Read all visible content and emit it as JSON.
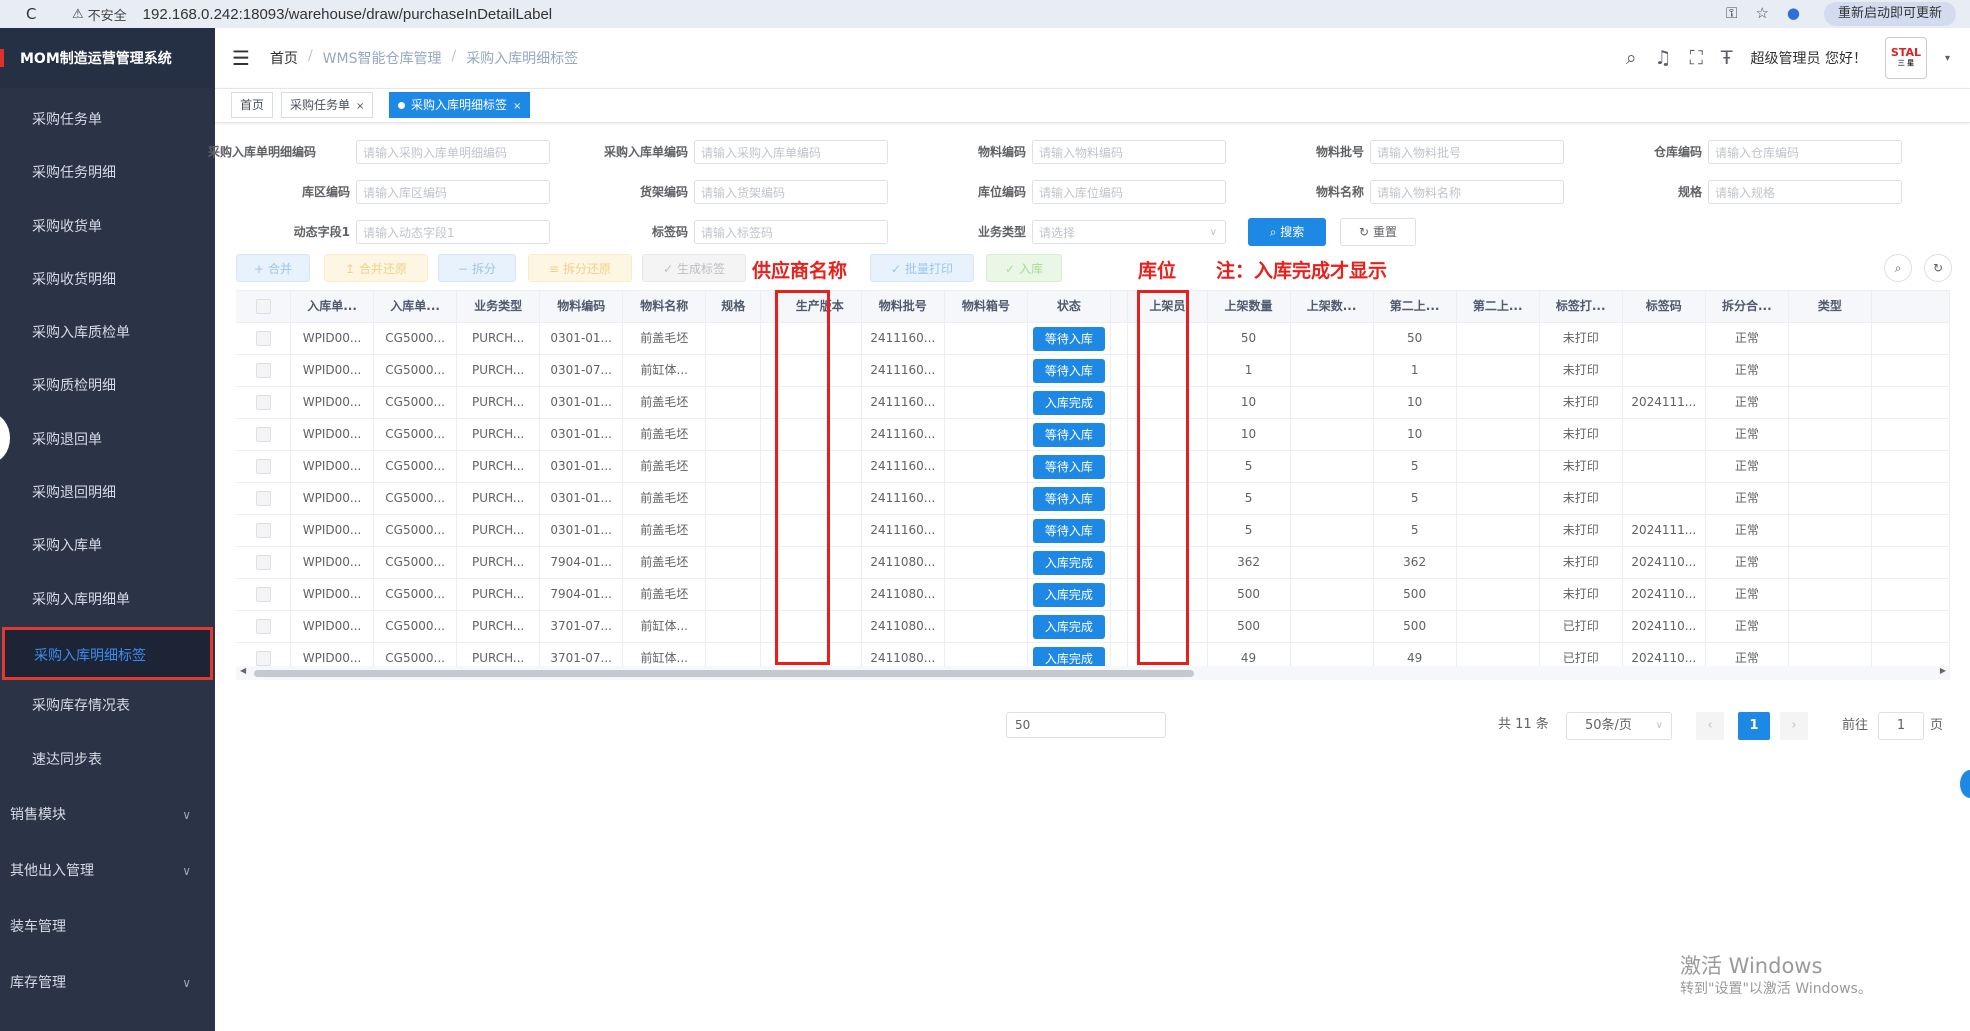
{
  "browser": {
    "reload": "C",
    "not_secure": "不安全",
    "url": "192.168.0.242:18093/warehouse/draw/purchaseInDetailLabel",
    "restart": "重新启动即可更新"
  },
  "sidebar": {
    "brand": "MOM制造运营管理系统",
    "items": [
      {
        "label": "采购任务单"
      },
      {
        "label": "采购任务明细"
      },
      {
        "label": "采购收货单"
      },
      {
        "label": "采购收货明细"
      },
      {
        "label": "采购入库质检单"
      },
      {
        "label": "采购质检明细"
      },
      {
        "label": "采购退回单"
      },
      {
        "label": "采购退回明细"
      },
      {
        "label": "采购入库单"
      },
      {
        "label": "采购入库明细单"
      },
      {
        "label": "采购入库明细标签"
      },
      {
        "label": "采购库存情况表"
      },
      {
        "label": "速达同步表"
      }
    ],
    "groups": [
      {
        "label": "销售模块"
      },
      {
        "label": "其他出入管理"
      },
      {
        "label": "装车管理"
      },
      {
        "label": "库存管理"
      }
    ]
  },
  "header": {
    "breadcrumb": [
      "首页",
      "WMS智能仓库管理",
      "采购入库明细标签"
    ],
    "greeting": "超级管理员 您好！",
    "avatar_text": "STAL",
    "avatar_sub": "三 星"
  },
  "tags": [
    {
      "label": "首页"
    },
    {
      "label": "采购任务单"
    },
    {
      "label": "采购入库明细标签"
    }
  ],
  "filters": [
    {
      "label": "采购入库单明细编码",
      "placeholder": "请输入采购入库单明细编码"
    },
    {
      "label": "采购入库单编码",
      "placeholder": "请输入采购入库单编码"
    },
    {
      "label": "物料编码",
      "placeholder": "请输入物料编码"
    },
    {
      "label": "物料批号",
      "placeholder": "请输入物料批号"
    },
    {
      "label": "仓库编码",
      "placeholder": "请输入仓库编码"
    },
    {
      "label": "库区编码",
      "placeholder": "请输入库区编码"
    },
    {
      "label": "货架编码",
      "placeholder": "请输入货架编码"
    },
    {
      "label": "库位编码",
      "placeholder": "请输入库位编码"
    },
    {
      "label": "物料名称",
      "placeholder": "请输入物料名称"
    },
    {
      "label": "规格",
      "placeholder": "请输入规格"
    },
    {
      "label": "动态字段1",
      "placeholder": "请输入动态字段1"
    },
    {
      "label": "标签码",
      "placeholder": "请输入标签码"
    },
    {
      "label": "业务类型",
      "placeholder": "请选择"
    }
  ],
  "buttons": {
    "search": "搜索",
    "reset": "重置"
  },
  "toolbar": [
    {
      "label": "合并",
      "icon": "+"
    },
    {
      "label": "合并还原",
      "icon": "↥"
    },
    {
      "label": "拆分",
      "icon": "−"
    },
    {
      "label": "拆分还原",
      "icon": "≡"
    },
    {
      "label": "生成标签",
      "icon": "✓"
    },
    {
      "label": "批量打印",
      "icon": "✓"
    },
    {
      "label": "入库",
      "icon": "✓"
    }
  ],
  "annotations": {
    "supplier": "供应商名称",
    "location": "库位",
    "note": "注：入库完成才显示"
  },
  "table": {
    "columns": [
      "",
      "入库单...",
      "入库单...",
      "业务类型",
      "物料编码",
      "物料名称",
      "规格",
      "",
      "生产版本",
      "物料批号",
      "物料箱号",
      "状态",
      "",
      "上架员",
      "上架数量",
      "上架数...",
      "第二上...",
      "第二上...",
      "标签打...",
      "标签码",
      "拆分合...",
      "类型",
      ""
    ],
    "rows": [
      {
        "c1": "WPID00...",
        "c2": "CG5000...",
        "c3": "PURCH...",
        "c4": "0301-01...",
        "c5": "前盖毛坯",
        "c9": "2411160...",
        "status": "等待入库",
        "c14": "50",
        "c16": "50",
        "c18": "未打印",
        "c19": "",
        "c20": "正常"
      },
      {
        "c1": "WPID00...",
        "c2": "CG5000...",
        "c3": "PURCH...",
        "c4": "0301-07...",
        "c5": "前缸体...",
        "c9": "2411160...",
        "status": "等待入库",
        "c14": "1",
        "c16": "1",
        "c18": "未打印",
        "c19": "",
        "c20": "正常"
      },
      {
        "c1": "WPID00...",
        "c2": "CG5000...",
        "c3": "PURCH...",
        "c4": "0301-01...",
        "c5": "前盖毛坯",
        "c9": "2411160...",
        "status": "入库完成",
        "c14": "10",
        "c16": "10",
        "c18": "未打印",
        "c19": "2024111...",
        "c20": "正常"
      },
      {
        "c1": "WPID00...",
        "c2": "CG5000...",
        "c3": "PURCH...",
        "c4": "0301-01...",
        "c5": "前盖毛坯",
        "c9": "2411160...",
        "status": "等待入库",
        "c14": "10",
        "c16": "10",
        "c18": "未打印",
        "c19": "",
        "c20": "正常"
      },
      {
        "c1": "WPID00...",
        "c2": "CG5000...",
        "c3": "PURCH...",
        "c4": "0301-01...",
        "c5": "前盖毛坯",
        "c9": "2411160...",
        "status": "等待入库",
        "c14": "5",
        "c16": "5",
        "c18": "未打印",
        "c19": "",
        "c20": "正常"
      },
      {
        "c1": "WPID00...",
        "c2": "CG5000...",
        "c3": "PURCH...",
        "c4": "0301-01...",
        "c5": "前盖毛坯",
        "c9": "2411160...",
        "status": "等待入库",
        "c14": "5",
        "c16": "5",
        "c18": "未打印",
        "c19": "",
        "c20": "正常"
      },
      {
        "c1": "WPID00...",
        "c2": "CG5000...",
        "c3": "PURCH...",
        "c4": "0301-01...",
        "c5": "前盖毛坯",
        "c9": "2411160...",
        "status": "等待入库",
        "c14": "5",
        "c16": "5",
        "c18": "未打印",
        "c19": "2024111...",
        "c20": "正常"
      },
      {
        "c1": "WPID00...",
        "c2": "CG5000...",
        "c3": "PURCH...",
        "c4": "7904-01...",
        "c5": "前盖毛坯",
        "c9": "2411080...",
        "status": "入库完成",
        "c14": "362",
        "c16": "362",
        "c18": "未打印",
        "c19": "2024110...",
        "c20": "正常"
      },
      {
        "c1": "WPID00...",
        "c2": "CG5000...",
        "c3": "PURCH...",
        "c4": "7904-01...",
        "c5": "前盖毛坯",
        "c9": "2411080...",
        "status": "入库完成",
        "c14": "500",
        "c16": "500",
        "c18": "未打印",
        "c19": "2024110...",
        "c20": "正常"
      },
      {
        "c1": "WPID00...",
        "c2": "CG5000...",
        "c3": "PURCH...",
        "c4": "3701-07...",
        "c5": "前缸体...",
        "c9": "2411080...",
        "status": "入库完成",
        "c14": "500",
        "c16": "500",
        "c18": "已打印",
        "c19": "2024110...",
        "c20": "正常"
      },
      {
        "c1": "WPID00...",
        "c2": "CG5000...",
        "c3": "PURCH...",
        "c4": "3701-07...",
        "c5": "前缸体...",
        "c9": "2411080...",
        "status": "入库完成",
        "c14": "49",
        "c16": "49",
        "c18": "已打印",
        "c19": "2024110...",
        "c20": "正常"
      }
    ]
  },
  "pagination": {
    "input_value": "50",
    "total": "共 11 条",
    "page_size": "50条/页",
    "current": "1",
    "goto_label": "前往",
    "goto_value": "1",
    "page_suffix": "页"
  },
  "watermark": {
    "title": "激活 Windows",
    "sub": "转到\"设置\"以激活 Windows。"
  },
  "colors": {
    "primary": "#1e88e5",
    "sidebar": "#2b3346",
    "annotation": "#e8201c"
  }
}
